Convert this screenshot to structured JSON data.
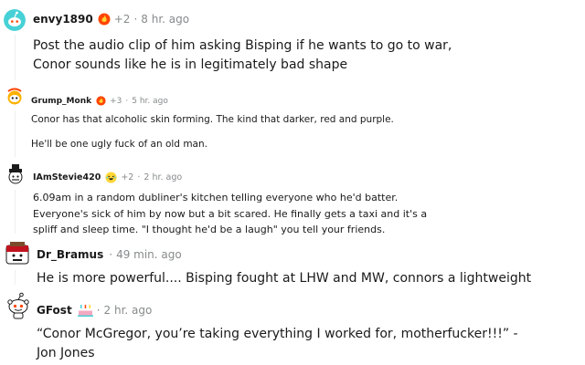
{
  "comments": [
    {
      "username": "envy1890",
      "award_icon": "fire-award-icon",
      "award_count": "+2",
      "separator": "·",
      "time": "8 hr. ago",
      "paragraphs": [
        "Post the audio clip of him asking Bisping if he wants to go to war, Conor sounds like he is in legitimately bad shape"
      ]
    },
    {
      "username": "Grump_Monk",
      "award_icon": "fire-award-icon",
      "award_count": "+3",
      "separator": "·",
      "time": "5 hr. ago",
      "paragraphs": [
        "Conor has that alcoholic skin forming. The kind that darker, red and purple.",
        "He'll be one ugly fuck of an old man."
      ]
    },
    {
      "username": "IAmStevie420",
      "award_icon": "laughing-award-icon",
      "award_count": "+2",
      "separator": "·",
      "time": "2 hr. ago",
      "paragraphs": [
        "6.09am in a random dubliner's kitchen telling everyone who he'd batter. Everyone's sick of him by now but a bit scared. He finally gets a taxi and it's a spliff and sleep time. \"I thought he'd be a laugh\" you tell your friends."
      ]
    },
    {
      "username": "Dr_Bramus",
      "separator": "·",
      "time": "49 min. ago",
      "paragraphs": [
        "He is more powerful.... Bisping fought at LHW and MW, connors a lightweight"
      ]
    },
    {
      "username": "GFost",
      "award_icon": "cake-flair-icon",
      "separator": "·",
      "time": "2 hr. ago",
      "paragraphs": [
        "“Conor McGregor, you’re taking everything I worked for, motherfucker!!!” - Jon Jones"
      ]
    }
  ],
  "colors": {
    "text": "#1a1a1b",
    "meta": "#878a8c",
    "thread_line": "#edeff1",
    "avatar_teal": "#46d1d6",
    "award_orange": "#ff4500"
  }
}
